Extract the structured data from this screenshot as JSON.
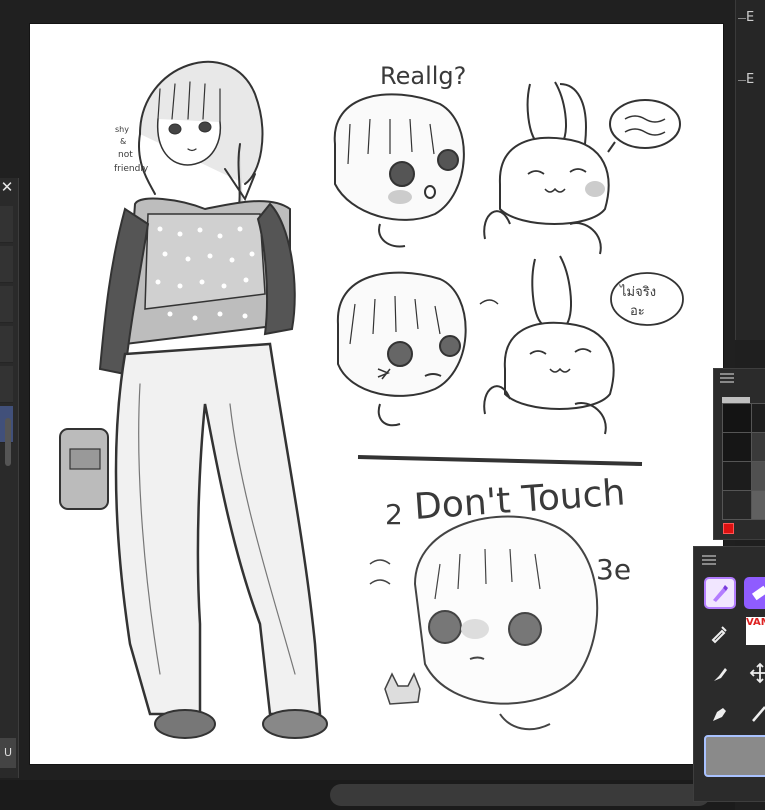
{
  "artwork": {
    "note_lines": [
      "shy",
      "&",
      "not",
      "friendly"
    ],
    "speech_reallg": "Reallg?",
    "dont_touch": "Don't Touch",
    "thai_bubble_line1": "ไม่จริง",
    "thai_bubble_line2": "อะ",
    "squiggle_2": "2",
    "squiggle_3e": "3e"
  },
  "left_panel": {
    "close_glyph": "✕",
    "tab_glyph": "U"
  },
  "right_panel": {
    "labels": [
      "E",
      "E"
    ]
  },
  "tool_palette": {
    "vam_label": "VAM"
  },
  "colors": {
    "app_bg": "#1f1f1f",
    "panel_bg": "#2b2b2b",
    "canvas_bg": "#ffffff",
    "active_tool": "#b37dff",
    "selection_highlight": "#a9c2ff",
    "current_color": "#d11111"
  },
  "icons": {
    "close": "close-icon",
    "panel_menu": "hamburger-icon",
    "pen": "pen-icon",
    "eraser": "eraser-icon",
    "dropper": "eyedropper-icon",
    "marker": "marker-icon",
    "move": "move-icon",
    "fountain_pen": "fountain-pen-icon",
    "pencil": "pencil-icon"
  }
}
